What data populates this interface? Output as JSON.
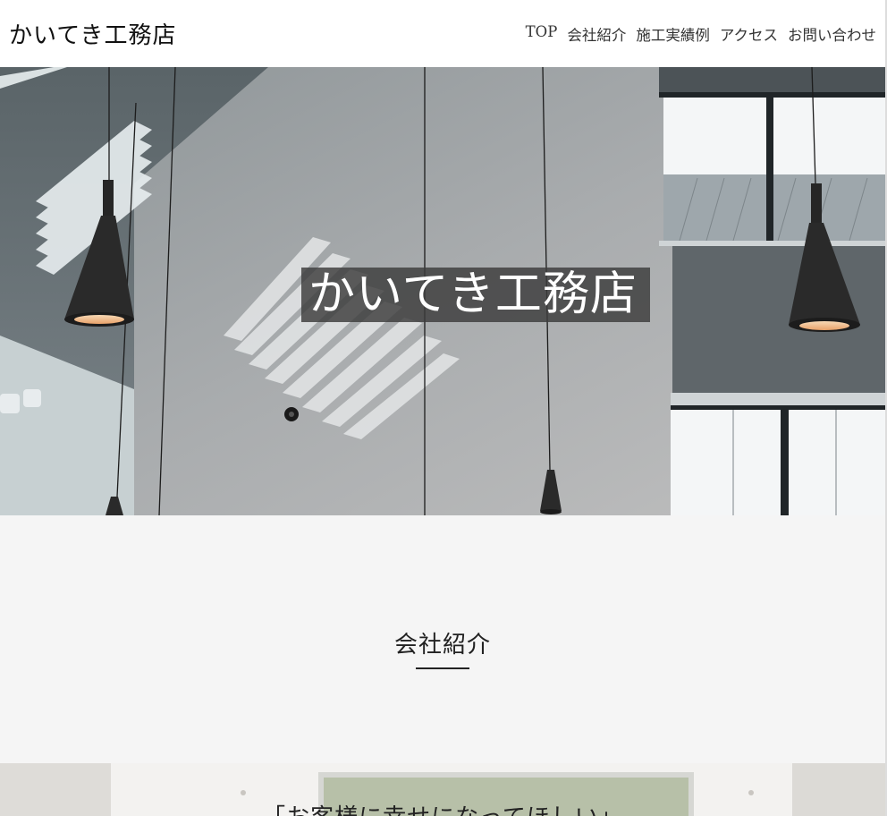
{
  "header": {
    "logo": "かいてき工務店",
    "nav": [
      {
        "label": "TOP"
      },
      {
        "label": "会社紹介"
      },
      {
        "label": "施工実績例"
      },
      {
        "label": "アクセス"
      },
      {
        "label": "お問い合わせ"
      }
    ]
  },
  "hero": {
    "title": "かいてき工務店"
  },
  "company": {
    "heading": "会社紹介",
    "catchphrase": "「お客様に幸せになってほしい」"
  },
  "colors": {
    "header_bg": "#ffffff",
    "section_bg": "#f5f5f5",
    "hero_title_bg": "#3c3c3c",
    "text": "#222222"
  }
}
